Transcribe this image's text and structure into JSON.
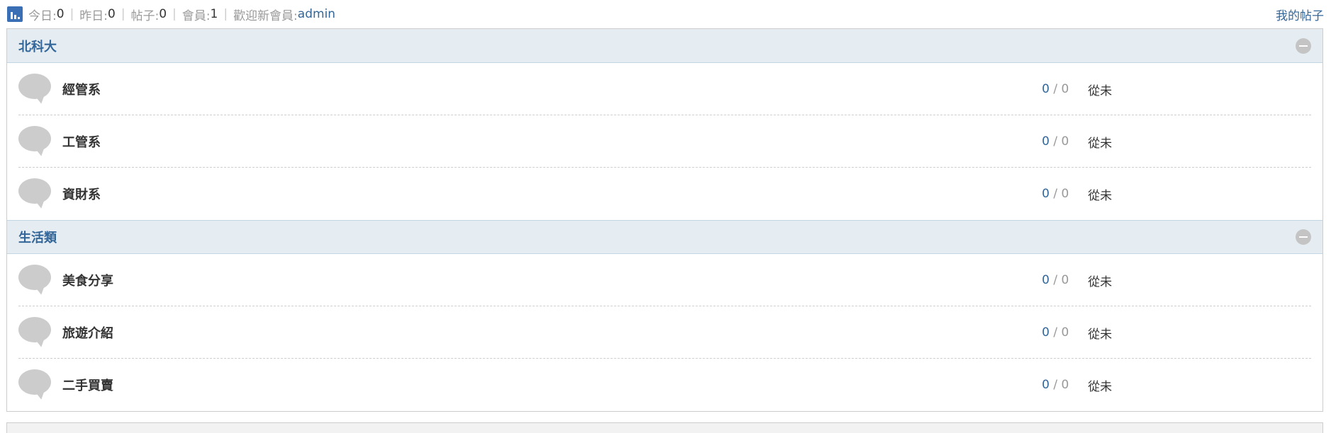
{
  "stats": {
    "icon": "chart-icon",
    "today_label": "今日:",
    "today_value": "0",
    "yesterday_label": "昨日:",
    "yesterday_value": "0",
    "posts_label": "帖子:",
    "posts_value": "0",
    "members_label": "會員:",
    "members_value": "1",
    "newest_label": "歡迎新會員:",
    "newest_user": "admin",
    "separator": "|",
    "my_posts": "我的帖子"
  },
  "categories": [
    {
      "title": "北科大",
      "forums": [
        {
          "name": "經管系",
          "threads": "0",
          "slash": "/",
          "posts": "0",
          "last": "從未"
        },
        {
          "name": "工管系",
          "threads": "0",
          "slash": "/",
          "posts": "0",
          "last": "從未"
        },
        {
          "name": "資財系",
          "threads": "0",
          "slash": "/",
          "posts": "0",
          "last": "從未"
        }
      ]
    },
    {
      "title": "生活類",
      "forums": [
        {
          "name": "美食分享",
          "threads": "0",
          "slash": "/",
          "posts": "0",
          "last": "從未"
        },
        {
          "name": "旅遊介紹",
          "threads": "0",
          "slash": "/",
          "posts": "0",
          "last": "從未"
        },
        {
          "name": "二手買賣",
          "threads": "0",
          "slash": "/",
          "posts": "0",
          "last": "從未"
        }
      ]
    }
  ],
  "colors": {
    "accent": "#336699",
    "header_bg": "#e5edf2",
    "icon_gray": "#cccccc"
  }
}
